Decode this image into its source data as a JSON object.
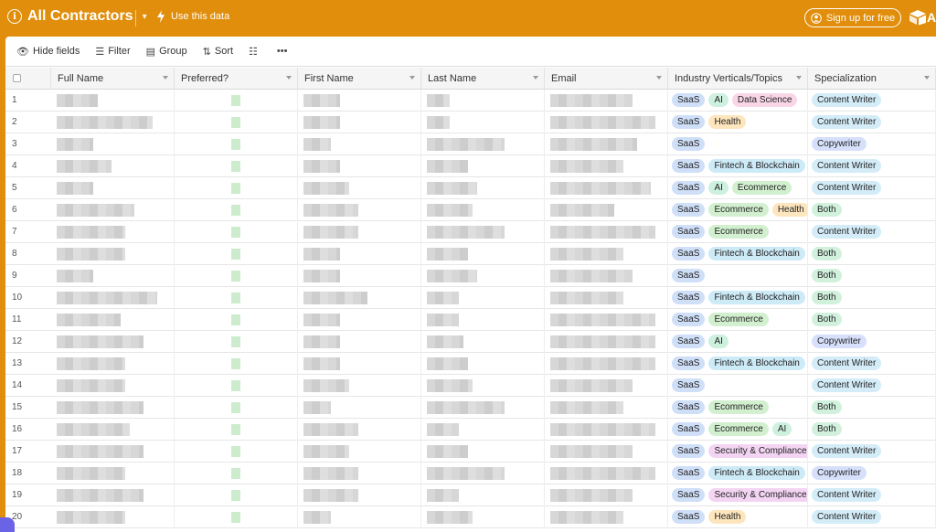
{
  "header": {
    "title": "All Contractors",
    "use_data_label": "Use this data",
    "signup_label": "Sign up for free",
    "logo_letter": "A",
    "accent_color": "#e08e0b"
  },
  "toolbar": {
    "hide_fields": "Hide fields",
    "filter": "Filter",
    "group": "Group",
    "sort": "Sort"
  },
  "columns": [
    "Full Name",
    "Preferred?",
    "First Name",
    "Last Name",
    "Email",
    "Industry Verticals/Topics",
    "Specialization"
  ],
  "tag_colors": {
    "SaaS": "#cfdff8",
    "AI": "#cdf0df",
    "Data Science": "#f9d6e6",
    "Health": "#fde5bd",
    "Fintech & Blockchain": "#cdeaf7",
    "Ecommerce": "#d2f0cf",
    "Security & Compliance": "#f3d5f3",
    "Content Writer": "#d3ecf8",
    "Copywriter": "#d7e0fb",
    "Both": "#d1f1dd"
  },
  "rows": [
    {
      "n": "1",
      "topics": [
        "SaaS",
        "AI",
        "Data Science"
      ],
      "spec": "Content Writer"
    },
    {
      "n": "2",
      "topics": [
        "SaaS",
        "Health"
      ],
      "spec": "Content Writer"
    },
    {
      "n": "3",
      "topics": [
        "SaaS"
      ],
      "spec": "Copywriter"
    },
    {
      "n": "4",
      "topics": [
        "SaaS",
        "Fintech & Blockchain"
      ],
      "spec": "Content Writer"
    },
    {
      "n": "5",
      "topics": [
        "SaaS",
        "AI",
        "Ecommerce"
      ],
      "spec": "Content Writer"
    },
    {
      "n": "6",
      "topics": [
        "SaaS",
        "Ecommerce",
        "Health"
      ],
      "spec": "Both"
    },
    {
      "n": "7",
      "topics": [
        "SaaS",
        "Ecommerce"
      ],
      "spec": "Content Writer"
    },
    {
      "n": "8",
      "topics": [
        "SaaS",
        "Fintech & Blockchain"
      ],
      "spec": "Both"
    },
    {
      "n": "9",
      "topics": [
        "SaaS"
      ],
      "spec": "Both"
    },
    {
      "n": "10",
      "topics": [
        "SaaS",
        "Fintech & Blockchain"
      ],
      "spec": "Both"
    },
    {
      "n": "11",
      "topics": [
        "SaaS",
        "Ecommerce"
      ],
      "spec": "Both"
    },
    {
      "n": "12",
      "topics": [
        "SaaS",
        "AI"
      ],
      "spec": "Copywriter"
    },
    {
      "n": "13",
      "topics": [
        "SaaS",
        "Fintech & Blockchain"
      ],
      "spec": "Content Writer"
    },
    {
      "n": "14",
      "topics": [
        "SaaS"
      ],
      "spec": "Content Writer"
    },
    {
      "n": "15",
      "topics": [
        "SaaS",
        "Ecommerce"
      ],
      "spec": "Both"
    },
    {
      "n": "16",
      "topics": [
        "SaaS",
        "Ecommerce",
        "AI"
      ],
      "spec": "Both"
    },
    {
      "n": "17",
      "topics": [
        "SaaS",
        "Security & Compliance"
      ],
      "spec": "Content Writer"
    },
    {
      "n": "18",
      "topics": [
        "SaaS",
        "Fintech & Blockchain"
      ],
      "spec": "Copywriter"
    },
    {
      "n": "19",
      "topics": [
        "SaaS",
        "Security & Compliance"
      ],
      "spec": "Content Writer"
    },
    {
      "n": "20",
      "topics": [
        "SaaS",
        "Health"
      ],
      "spec": "Content Writer"
    }
  ]
}
